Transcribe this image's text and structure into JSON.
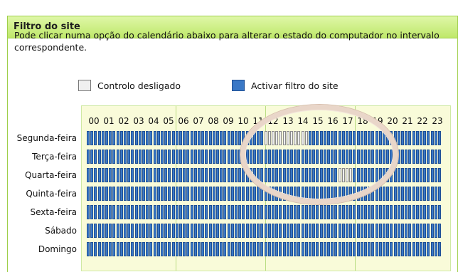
{
  "panel": {
    "title": "Filtro do site",
    "description": "Pode clicar numa opção do calendário abaixo para alterar o estado do computador no intervalo correspondente."
  },
  "legend": {
    "off_label": "Controlo desligado",
    "on_label": "Activar filtro do site"
  },
  "colors": {
    "on": "#3a78c6",
    "off": "#eeeeee",
    "header_green": "#bfe86a"
  },
  "hours": [
    "00",
    "01",
    "02",
    "03",
    "04",
    "05",
    "06",
    "07",
    "08",
    "09",
    "10",
    "11",
    "12",
    "13",
    "14",
    "15",
    "16",
    "17",
    "18",
    "19",
    "20",
    "21",
    "22",
    "23"
  ],
  "days": [
    "Segunda-feira",
    "Terça-feira",
    "Quarta-feira",
    "Quinta-feira",
    "Sexta-feira",
    "Sábado",
    "Domingo"
  ],
  "cells_per_hour": 4,
  "off_cells": [
    {
      "day": 0,
      "hour": 12,
      "slots": [
        0,
        1,
        2,
        3
      ]
    },
    {
      "day": 0,
      "hour": 13,
      "slots": [
        0,
        1,
        2,
        3
      ]
    },
    {
      "day": 0,
      "hour": 14,
      "slots": [
        0,
        1,
        2,
        3
      ]
    },
    {
      "day": 2,
      "hour": 17,
      "slots": [
        0,
        1,
        2,
        3
      ]
    }
  ]
}
